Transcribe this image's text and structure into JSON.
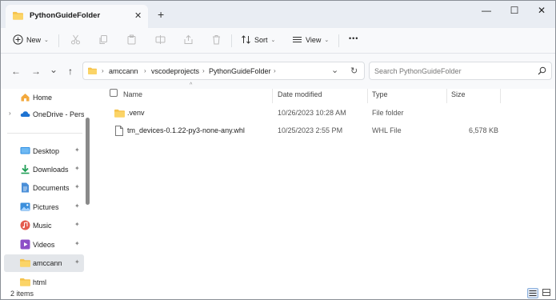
{
  "window": {
    "tab_title": "PythonGuideFolder",
    "new_tab_glyph": "+",
    "close_tab_glyph": "✕",
    "minimize_glyph": "—",
    "maximize_glyph": "☐",
    "close_glyph": "✕"
  },
  "commandbar": {
    "new_label": "New",
    "sort_label": "Sort",
    "view_label": "View",
    "more_glyph": "•••",
    "chevron": "⌄"
  },
  "address": {
    "back_glyph": "←",
    "forward_glyph": "→",
    "recent_glyph": "⌄",
    "up_glyph": "↑",
    "crumbs": [
      "amccann",
      "vscodeprojects",
      "PythonGuideFolder"
    ],
    "separator": "›",
    "dropdown_glyph": "⌄",
    "refresh_glyph": "↻",
    "search_placeholder": "Search PythonGuideFolder"
  },
  "navpane": {
    "items": [
      {
        "label": "Home",
        "icon": "home-icon"
      },
      {
        "label": "OneDrive - Perso",
        "icon": "cloud-icon"
      },
      {
        "label": "Desktop",
        "icon": "desktop-icon"
      },
      {
        "label": "Downloads",
        "icon": "download-icon"
      },
      {
        "label": "Documents",
        "icon": "document-icon"
      },
      {
        "label": "Pictures",
        "icon": "picture-icon"
      },
      {
        "label": "Music",
        "icon": "music-icon"
      },
      {
        "label": "Videos",
        "icon": "video-icon"
      },
      {
        "label": "amccann",
        "icon": "folder-icon"
      },
      {
        "label": "html",
        "icon": "folder-icon"
      }
    ],
    "expander": "›",
    "pin": "📌"
  },
  "columns": {
    "name": "Name",
    "date": "Date modified",
    "type": "Type",
    "size": "Size"
  },
  "files": [
    {
      "name": ".venv",
      "date": "10/26/2023 10:28 AM",
      "type": "File folder",
      "size": "",
      "icon": "folder-icon"
    },
    {
      "name": "tm_devices-0.1.22-py3-none-any.whl",
      "date": "10/25/2023 2:55 PM",
      "type": "WHL File",
      "size": "6,578 KB",
      "icon": "file-icon"
    }
  ],
  "status": {
    "item_count": "2 items"
  },
  "colors": {
    "folder": "#f5c24b",
    "accent": "#0067c0"
  }
}
